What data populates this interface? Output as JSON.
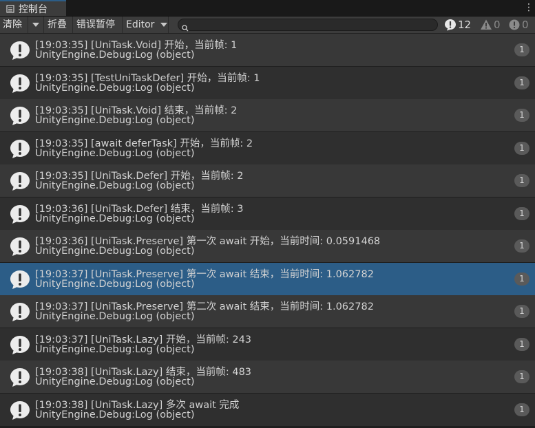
{
  "window": {
    "tab_title": "控制台",
    "menu_label": "⋮"
  },
  "toolbar": {
    "clear_label": "清除",
    "collapse_label": "折叠",
    "error_pause_label": "错误暂停",
    "editor_label": "Editor",
    "search_placeholder": "",
    "search_value": "",
    "counters": {
      "log": "12",
      "warning": "0",
      "error": "0"
    }
  },
  "colors": {
    "selected": "#2c5d87",
    "row_even": "#383838",
    "row_odd": "#2f2f2f"
  },
  "entries": [
    {
      "line1": "[19:03:35] [UniTask.Void] 开始，当前帧: 1",
      "line2": "UnityEngine.Debug:Log (object)",
      "count": "1"
    },
    {
      "line1": "[19:03:35] [TestUniTaskDefer] 开始，当前帧: 1",
      "line2": "UnityEngine.Debug:Log (object)",
      "count": "1"
    },
    {
      "line1": "[19:03:35] [UniTask.Void] 结束，当前帧: 2",
      "line2": "UnityEngine.Debug:Log (object)",
      "count": "1"
    },
    {
      "line1": "[19:03:35] [await deferTask] 开始，当前帧: 2",
      "line2": "UnityEngine.Debug:Log (object)",
      "count": "1"
    },
    {
      "line1": "[19:03:35] [UniTask.Defer] 开始，当前帧: 2",
      "line2": "UnityEngine.Debug:Log (object)",
      "count": "1"
    },
    {
      "line1": "[19:03:36] [UniTask.Defer] 结束，当前帧: 3",
      "line2": "UnityEngine.Debug:Log (object)",
      "count": "1"
    },
    {
      "line1": "[19:03:36] [UniTask.Preserve] 第一次 await 开始，当前时间: 0.0591468",
      "line2": "UnityEngine.Debug:Log (object)",
      "count": "1"
    },
    {
      "line1": "[19:03:37] [UniTask.Preserve] 第一次 await 结束，当前时间: 1.062782",
      "line2": "UnityEngine.Debug:Log (object)",
      "count": "1",
      "selected": true
    },
    {
      "line1": "[19:03:37] [UniTask.Preserve] 第二次 await 结束，当前时间: 1.062782",
      "line2": "UnityEngine.Debug:Log (object)",
      "count": "1"
    },
    {
      "line1": "[19:03:37] [UniTask.Lazy] 开始，当前帧: 243",
      "line2": "UnityEngine.Debug:Log (object)",
      "count": "1"
    },
    {
      "line1": "[19:03:38] [UniTask.Lazy] 结束，当前帧: 483",
      "line2": "UnityEngine.Debug:Log (object)",
      "count": "1"
    },
    {
      "line1": "[19:03:38] [UniTask.Lazy] 多次 await 完成",
      "line2": "UnityEngine.Debug:Log (object)",
      "count": "1"
    }
  ]
}
